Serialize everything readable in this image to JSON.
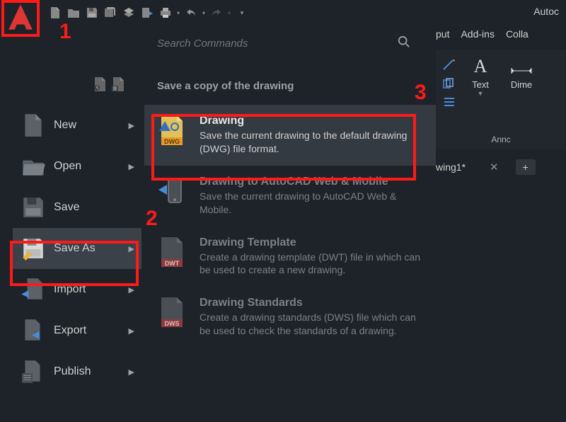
{
  "app": {
    "title": "Autoc"
  },
  "qat_icons": [
    "new-doc",
    "open-folder",
    "save",
    "save-all",
    "layers",
    "share",
    "print",
    "undo",
    "undo-dd",
    "redo",
    "redo-dd",
    "menu-dd"
  ],
  "ribbon": {
    "tabs": [
      "put",
      "Add-ins",
      "Colla"
    ],
    "buttons": {
      "text": "Text",
      "dim": "Dime"
    },
    "panel": "Annc"
  },
  "file_tab": {
    "name": "wing1*",
    "close": "✕",
    "plus": "+"
  },
  "search": {
    "placeholder": "Search Commands"
  },
  "submenu_heading": "Save a copy of the drawing",
  "menu": {
    "items": [
      {
        "label": "New",
        "arrow": true
      },
      {
        "label": "Open",
        "arrow": true
      },
      {
        "label": "Save",
        "arrow": false
      },
      {
        "label": "Save As",
        "arrow": true
      },
      {
        "label": "Import",
        "arrow": true
      },
      {
        "label": "Export",
        "arrow": true
      },
      {
        "label": "Publish",
        "arrow": true
      }
    ]
  },
  "options": [
    {
      "title": "Drawing",
      "desc": "Save the current drawing to the default drawing (DWG) file format.",
      "icon_tag": "DWG",
      "dim": false
    },
    {
      "title": "Drawing to AutoCAD Web & Mobile",
      "desc": "Save the current drawing to AutoCAD Web & Mobile.",
      "icon_tag": "",
      "dim": true
    },
    {
      "title": "Drawing Template",
      "desc": "Create a drawing template (DWT) file in which can be used to create a new drawing.",
      "icon_tag": "DWT",
      "dim": true
    },
    {
      "title": "Drawing Standards",
      "desc": "Create a drawing standards (DWS) file which can be used to check the standards of a drawing.",
      "icon_tag": "DWS",
      "dim": true
    }
  ],
  "annotations": {
    "n1": "1",
    "n2": "2",
    "n3": "3"
  }
}
